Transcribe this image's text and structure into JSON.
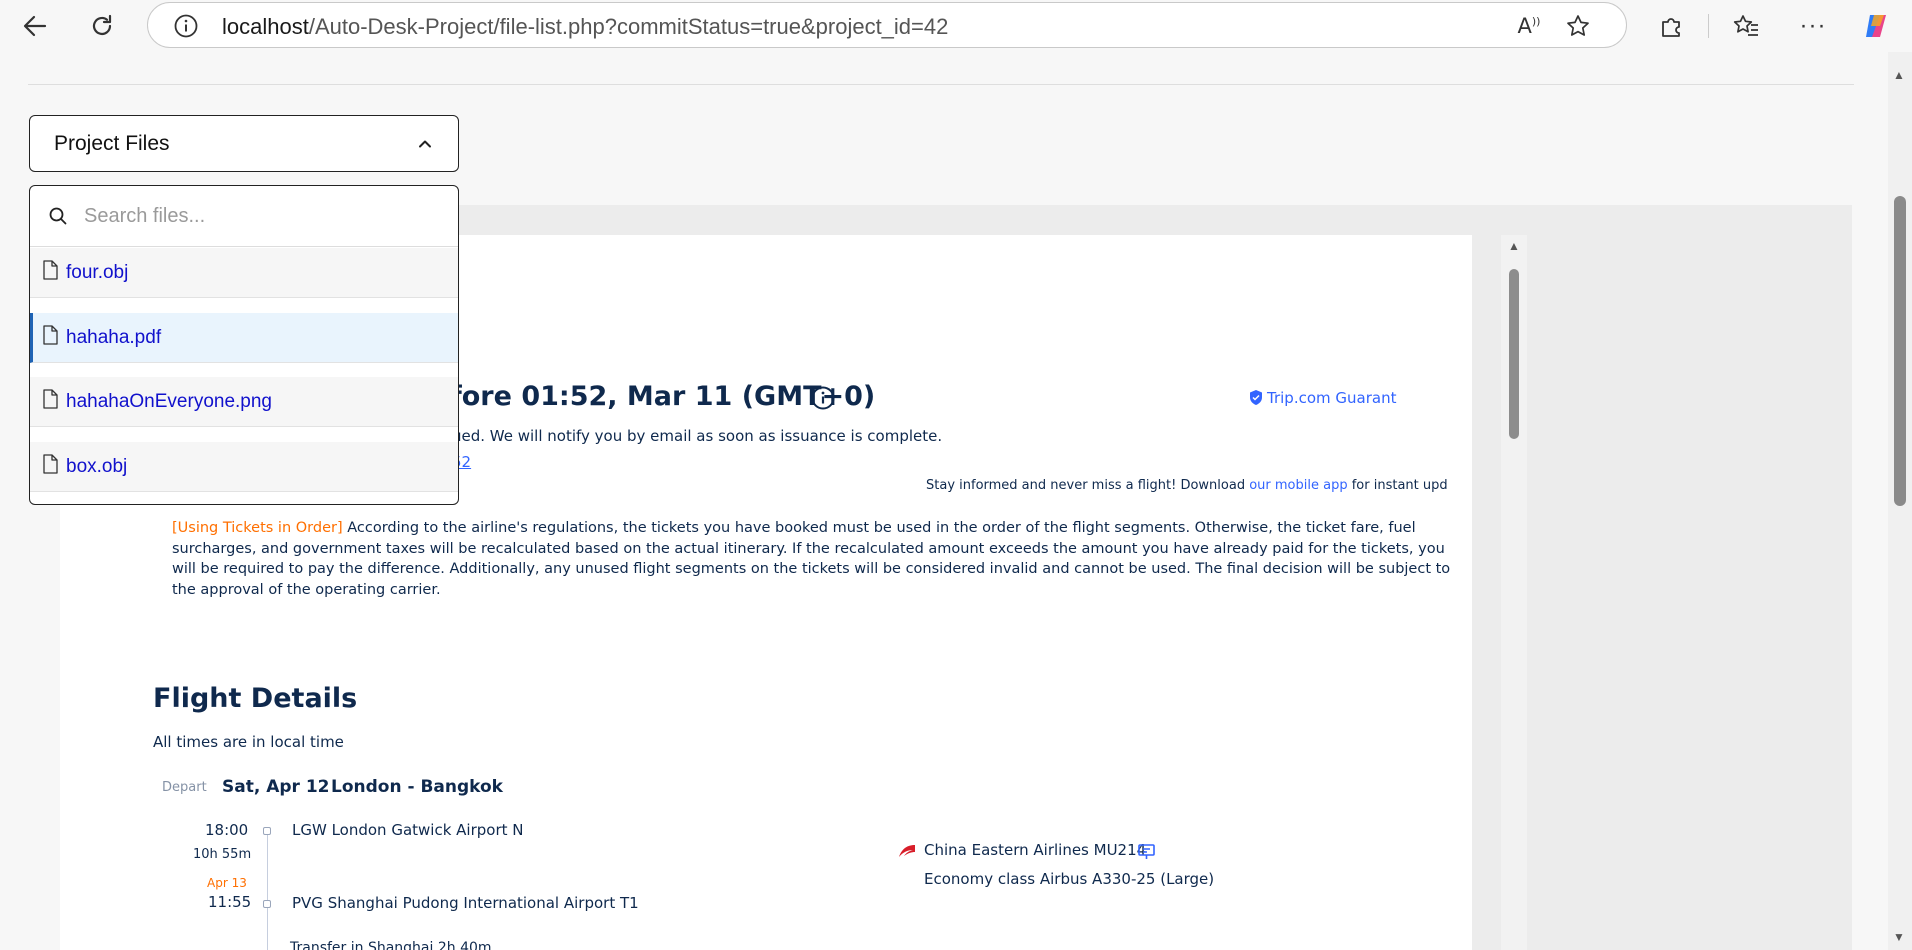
{
  "browser": {
    "url_host": "localhost",
    "url_path": "/Auto-Desk-Project/file-list.php?commitStatus=true&project_id=42",
    "icons": [
      "back-icon",
      "refresh-icon",
      "info-icon",
      "read-aloud-icon",
      "favorite-star-icon",
      "extensions-icon",
      "favorites-icon",
      "more-icon",
      "copilot-icon"
    ]
  },
  "dropdown": {
    "label": "Project Files",
    "expanded": true,
    "search_placeholder": "Search files...",
    "files": [
      {
        "name": "four.obj",
        "selected": false
      },
      {
        "name": "hahaha.pdf",
        "selected": true
      },
      {
        "name": "hahahaOnEveryone.png",
        "selected": false
      },
      {
        "name": "box.obj",
        "selected": false
      }
    ]
  },
  "document": {
    "deadline": "fore 01:52, Mar 11 (GMT+0)",
    "guarantee": "Trip.com Guarant",
    "issued_text": "ued. We will notify you by email as soon as issuance is complete.",
    "fragment_link": "52",
    "stay_prefix": "Stay informed and never miss a flight! Download ",
    "stay_link": "our mobile app",
    "stay_suffix": " for instant upd",
    "notice_tag": "[Using Tickets in Order]",
    "notice_text": " According to the airline's regulations, the tickets you have booked must be used in the order of the flight segments. Otherwise, the ticket fare, fuel surcharges, and government taxes will be recalculated based on the actual itinerary. If the recalculated amount exceeds the amount you have already paid for the tickets, you will be required to pay the difference. Additionally, any unused flight segments on the tickets will be considered invalid and cannot be used. The final decision will be subject to the approval of the operating carrier.",
    "flight_details_title": "Flight Details",
    "local_time_note": "All times are in local time",
    "segment": {
      "depart_label": "Depart",
      "date": "Sat, Apr 12",
      "route": "London - Bangkok",
      "dep_time": "18:00",
      "duration": "10h 55m",
      "arr_date": "Apr 13",
      "arr_time": "11:55",
      "dep_airport": "LGW  London Gatwick Airport N",
      "arr_airport": "PVG  Shanghai Pudong International Airport T1",
      "transfer": "Transfer in Shanghai  2h 40m",
      "airline": "China Eastern Airlines MU214",
      "cabin": "Economy class     Airbus A330-25 (Large)"
    }
  }
}
